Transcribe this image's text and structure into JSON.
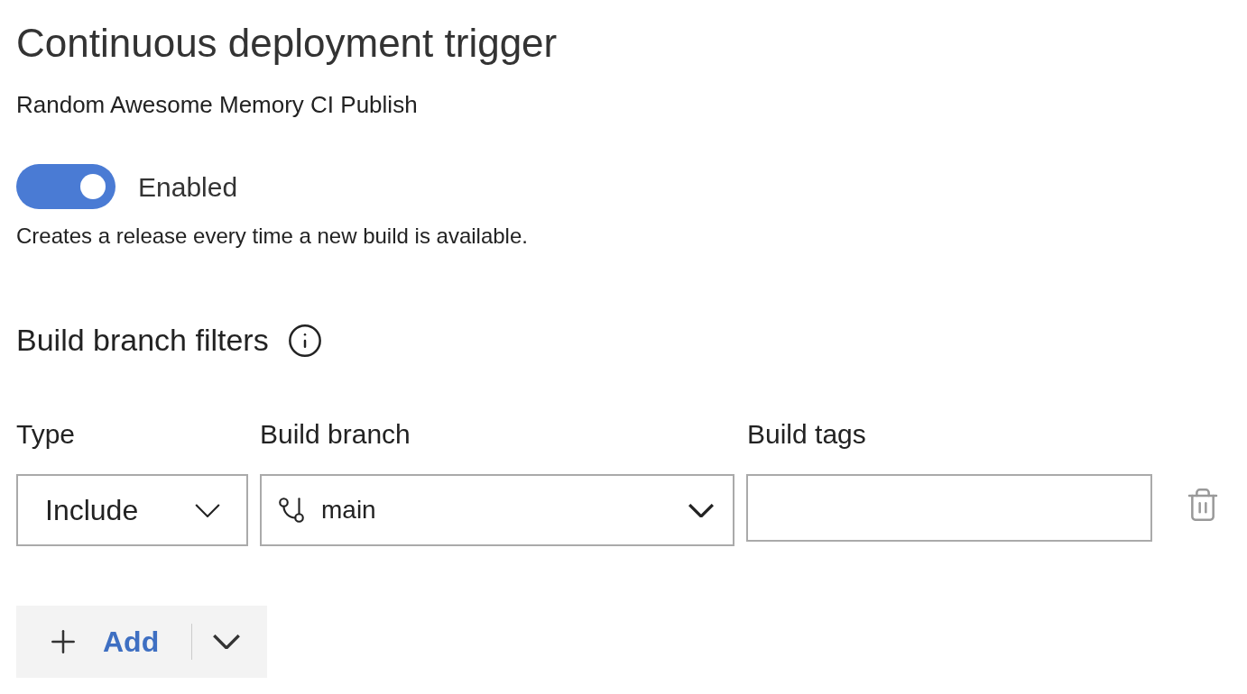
{
  "title": "Continuous deployment trigger",
  "subtitle": "Random Awesome Memory CI Publish",
  "toggle": {
    "on": true,
    "label": "Enabled"
  },
  "description": "Creates a release every time a new build is available.",
  "section": {
    "title": "Build branch filters"
  },
  "columns": [
    "Type",
    "Build branch",
    "Build tags"
  ],
  "filter_row": {
    "type": "Include",
    "branch": "main"
  },
  "add_button": {
    "label": "Add"
  }
}
